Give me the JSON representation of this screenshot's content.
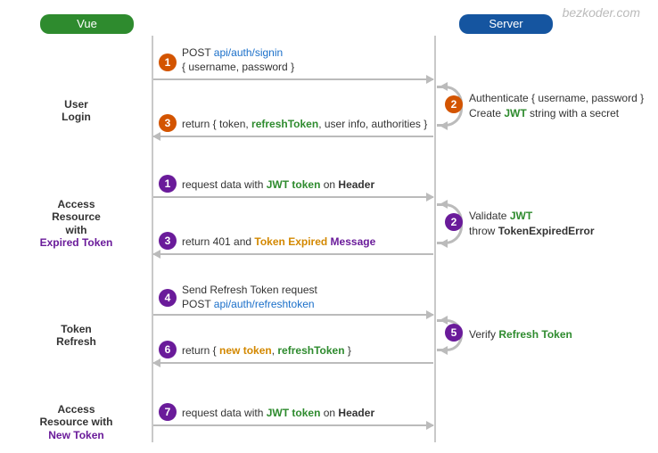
{
  "watermark": "bezkoder.com",
  "headers": {
    "vue": "Vue",
    "server": "Server"
  },
  "sections": {
    "login": {
      "l1": "User",
      "l2": "Login"
    },
    "expired": {
      "l1": "Access",
      "l2": "Resource",
      "l3": "with",
      "l4": "Expired Token"
    },
    "refresh": {
      "l1": "Token",
      "l2": "Refresh"
    },
    "newtoken": {
      "l1": "Access",
      "l2": "Resource with",
      "l3": "New Token"
    }
  },
  "steps": {
    "s1": "1",
    "s2": "2",
    "s3": "3",
    "s4": "4",
    "s5": "5",
    "s6": "6",
    "s7": "7",
    "p1": "1",
    "p2": "2",
    "p3": "3"
  },
  "msgs": {
    "m1a": "POST ",
    "m1b": "api/auth/signin",
    "m1c": "{ username, password }",
    "m2a": "Authenticate { username, password }",
    "m2b1": "Create ",
    "m2b2": "JWT",
    "m2b3": " string with a secret",
    "m3a": "return { token, ",
    "m3b": "refreshToken",
    "m3c": ", user info, authorities }",
    "e1a": "request data with ",
    "e1b": "JWT token",
    "e1c": " on ",
    "e1d": "Header",
    "e2a": "Validate ",
    "e2b": "JWT",
    "e2c": "throw ",
    "e2d": "TokenExpiredError",
    "e3a": "return 401 and ",
    "e3b": "Token Expired",
    "e3c": " ",
    "e3d": "Message",
    "r4a": "Send Refresh Token request",
    "r4b": "POST ",
    "r4c": "api/auth/refreshtoken",
    "r5a": "Verify ",
    "r5b": "Refresh Token",
    "r6a": "return { ",
    "r6b": "new token",
    "r6c": ", ",
    "r6d": "refreshToken",
    "r6e": " }",
    "n7a": "request data with ",
    "n7b": "JWT token",
    "n7c": " on ",
    "n7d": "Header"
  }
}
